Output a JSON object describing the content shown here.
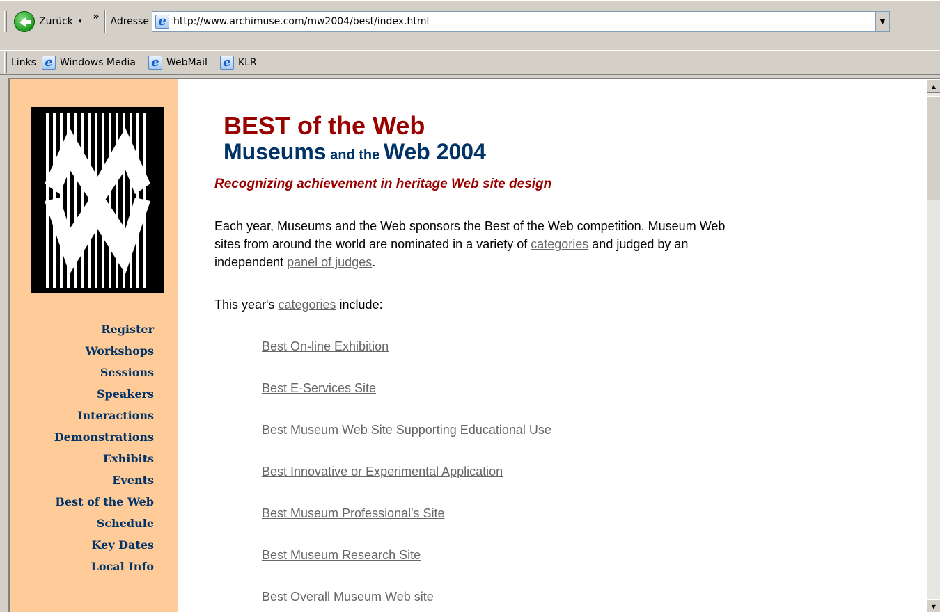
{
  "toolbar": {
    "back_label": "Zurück",
    "dropdown_arrow": "▾",
    "chevron": "»",
    "address_label": "Adresse",
    "url": "http://www.archimuse.com/mw2004/best/index.html"
  },
  "links_bar": {
    "label": "Links",
    "items": [
      {
        "label": "Windows Media"
      },
      {
        "label": "WebMail"
      },
      {
        "label": "KLR"
      }
    ]
  },
  "sidebar": {
    "nav": [
      {
        "label": "Register"
      },
      {
        "label": "Workshops"
      },
      {
        "label": "Sessions"
      },
      {
        "label": "Speakers"
      },
      {
        "label": "Interactions"
      },
      {
        "label": "Demonstrations"
      },
      {
        "label": "Exhibits"
      },
      {
        "label": "Events"
      },
      {
        "label": "Best of the Web"
      },
      {
        "label": "Schedule"
      },
      {
        "label": "Key Dates"
      },
      {
        "label": "Local Info"
      }
    ]
  },
  "main": {
    "title_line1": "BEST of the Web",
    "title_line2_big1": "Museums",
    "title_line2_small": " and the ",
    "title_line2_big2": "Web 2004",
    "tagline": "Recognizing achievement in heritage Web site design",
    "intro_text1": "Each year, Museums and the Web sponsors the Best of the Web competition. Museum Web sites from around the world are nominated in a variety of ",
    "intro_link1": "categories",
    "intro_text2": " and judged by an independent ",
    "intro_link2": "panel of judges",
    "intro_text3": ".",
    "cats_prefix": "This year's ",
    "cats_link": "categories",
    "cats_suffix": " include:",
    "categories": [
      "Best On-line Exhibition",
      "Best E-Services Site",
      "Best Museum Web Site Supporting Educational Use",
      "Best Innovative or Experimental Application",
      "Best Museum Professional's Site",
      "Best Museum Research Site",
      "Best Overall Museum Web site"
    ]
  },
  "colors": {
    "sidebar_bg": "#ffcc99",
    "nav_text": "#003366",
    "title_red": "#990000",
    "title_blue": "#003366",
    "link_gray": "#666666"
  }
}
